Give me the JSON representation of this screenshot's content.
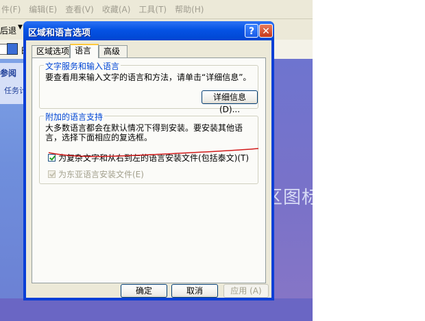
{
  "background": {
    "menu": [
      "件(F)",
      "编辑(E)",
      "查看(V)",
      "收藏(A)",
      "工具(T)",
      "帮助(H)"
    ],
    "toolbar_back": "后退",
    "toolbar2_text": "日",
    "left_title": "参阅",
    "left_task": "任务计",
    "right_text": "区图标"
  },
  "dialog": {
    "title": "区域和语言选项",
    "help_label": "?",
    "close_label": "✕",
    "tabs": [
      {
        "label": "区域选项"
      },
      {
        "label": "语言"
      },
      {
        "label": "高级"
      }
    ],
    "group1": {
      "legend": "文字服务和输入语言",
      "description": "要查看用来输入文字的语言和方法，请单击“详细信息”。",
      "details_button": "详细信息 (D)..."
    },
    "group2": {
      "legend": "附加的语言支持",
      "description": "大多数语言都会在默认情况下得到安装。要安装其他语言，选择下面相应的复选框。",
      "checkbox1_label": "为复杂文字和从右到左的语言安装文件(包括泰文)(T)",
      "checkbox1_checked": true,
      "checkbox2_label": "为东亚语言安装文件(E)",
      "checkbox2_checked": true
    },
    "ok_button": "确定",
    "cancel_button": "取消",
    "apply_button": "应用 (A)"
  },
  "colors": {
    "title_bar": "#0553e4",
    "legend_text": "#0046d5",
    "annotation": "#d21a1a",
    "check_mark": "#21a121"
  }
}
